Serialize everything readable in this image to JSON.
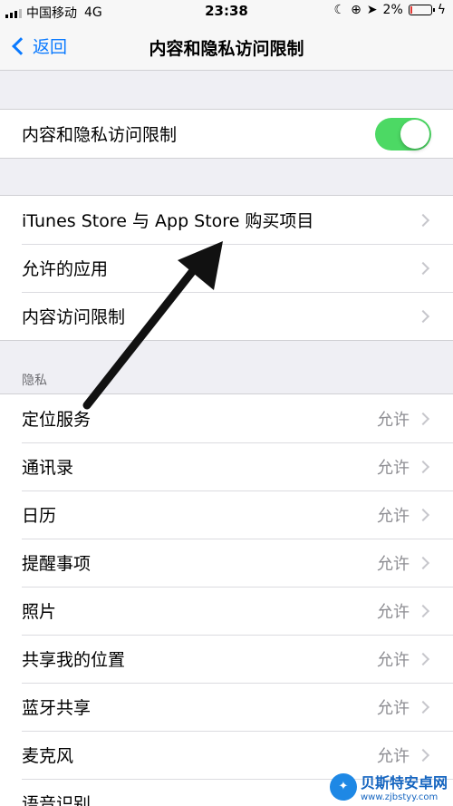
{
  "status_bar": {
    "carrier": "中国移动",
    "network": "4G",
    "time": "23:38",
    "battery": "2%",
    "battery_level": 0.02
  },
  "nav": {
    "back_label": "返回",
    "title": "内容和隐私访问限制"
  },
  "toggle_row": {
    "label": "内容和隐私访问限制",
    "enabled": true
  },
  "store_group": [
    {
      "label": "iTunes Store 与 App Store 购买项目"
    },
    {
      "label": "允许的应用"
    },
    {
      "label": "内容访问限制"
    }
  ],
  "privacy": {
    "header": "隐私",
    "items": [
      {
        "label": "定位服务",
        "value": "允许"
      },
      {
        "label": "通讯录",
        "value": "允许"
      },
      {
        "label": "日历",
        "value": "允许"
      },
      {
        "label": "提醒事项",
        "value": "允许"
      },
      {
        "label": "照片",
        "value": "允许"
      },
      {
        "label": "共享我的位置",
        "value": "允许"
      },
      {
        "label": "蓝牙共享",
        "value": "允许"
      },
      {
        "label": "麦克风",
        "value": "允许"
      },
      {
        "label": "语音识别",
        "value": ""
      }
    ]
  },
  "watermark": {
    "title": "贝斯特安卓网",
    "url": "www.zjbstyy.com"
  },
  "colors": {
    "accent": "#0a7aff",
    "toggle_on": "#4cd964"
  }
}
